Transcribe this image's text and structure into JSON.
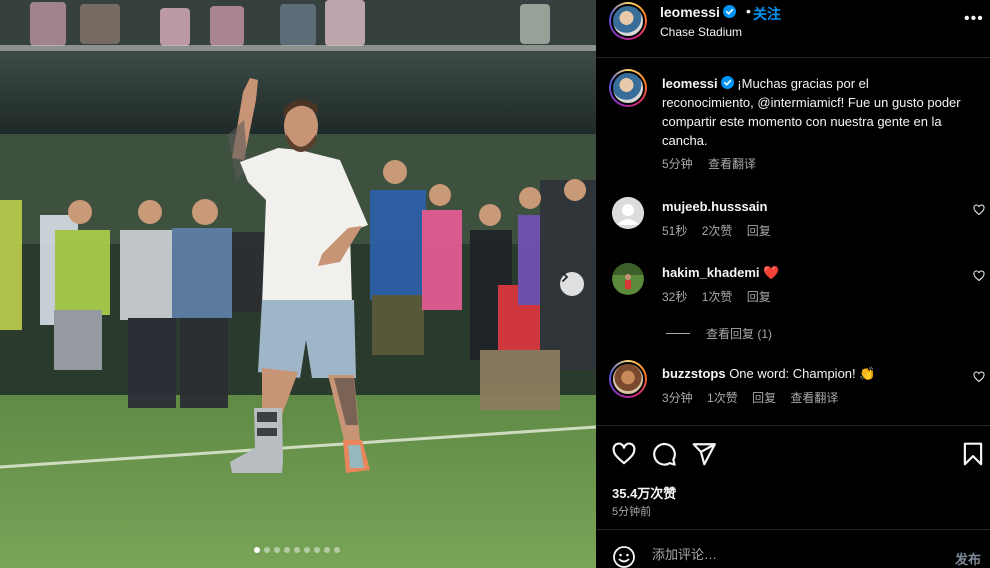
{
  "post": {
    "username": "leomessi",
    "verified": true,
    "separator": "•",
    "follow_label": "关注",
    "location": "Chase Stadium",
    "more_label": "•••"
  },
  "caption": {
    "username": "leomessi",
    "text": "¡Muchas gracias por el reconocimiento, @intermiamicf! Fue un gusto poder compartir este momento con nuestra gente en la cancha.",
    "time": "5分钟",
    "translate_label": "查看翻译"
  },
  "comments": [
    {
      "username": "mujeeb.husssain",
      "text": "",
      "time": "51秒",
      "likes": "2次赞",
      "reply_label": "回复",
      "translate_label": ""
    },
    {
      "username": "hakim_khademi",
      "text": "❤️",
      "time": "32秒",
      "likes": "1次赞",
      "reply_label": "回复",
      "translate_label": ""
    },
    {
      "username": "buzzstops",
      "text": "One word: Champion! 👏",
      "time": "3分钟",
      "likes": "1次赞",
      "reply_label": "回复",
      "translate_label": "查看翻译"
    }
  ],
  "view_replies_label": "查看回复 (1)",
  "stats": {
    "likes": "35.4万次赞",
    "posted_ago": "5分钟前"
  },
  "add_comment": {
    "placeholder": "添加评论…",
    "post_label": "发布"
  },
  "carousel": {
    "total": 9,
    "current": 1
  },
  "colors": {
    "background": "#000000",
    "accent": "#0095f6",
    "muted_text": "#a8a8a8",
    "divider": "#262626",
    "heart_red": "#ed4956"
  }
}
